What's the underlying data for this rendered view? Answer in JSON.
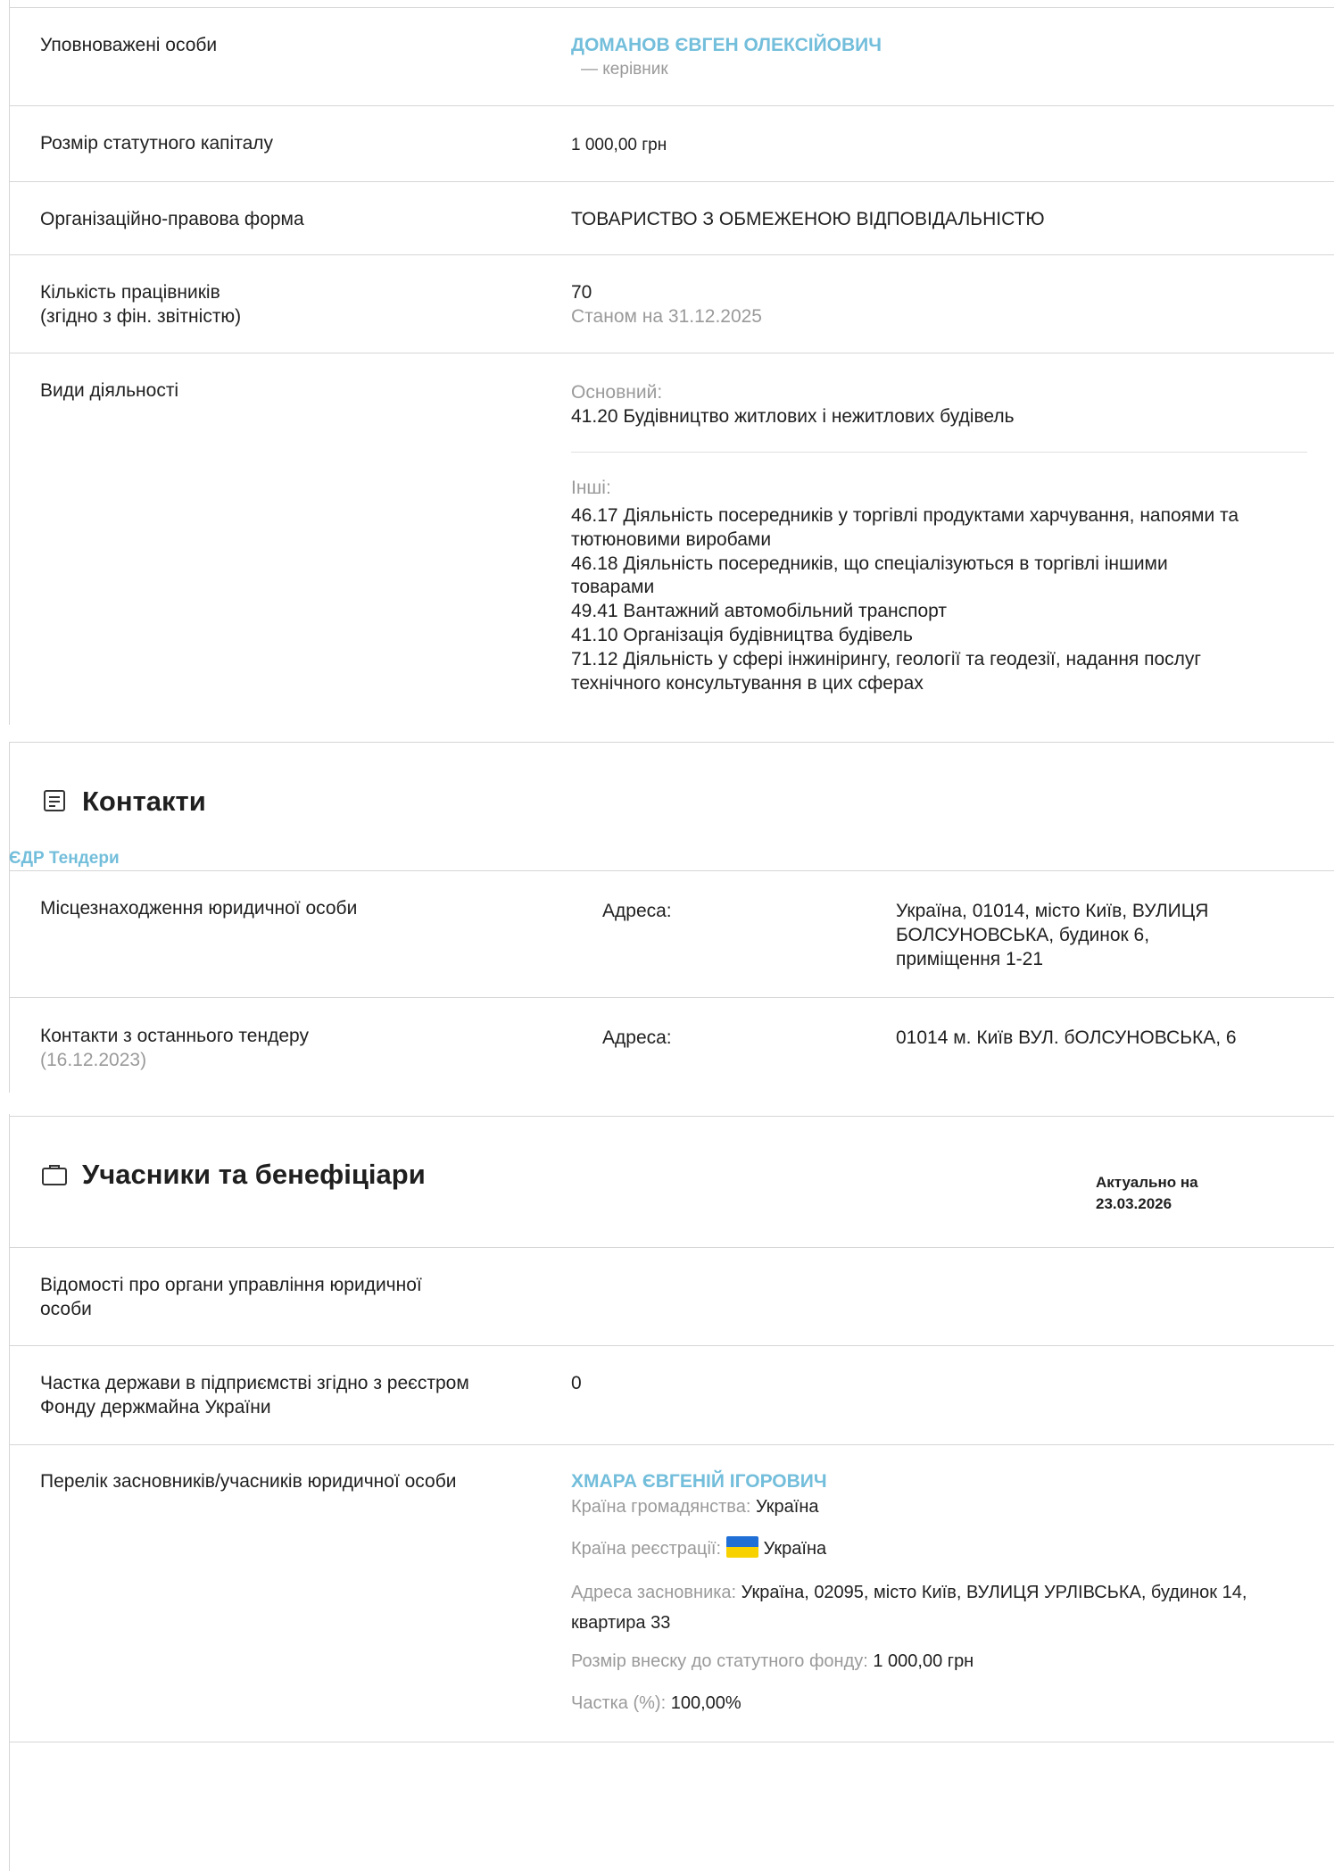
{
  "top_rows": {
    "authorized_persons": {
      "label": "Уповноважені особи",
      "name": "ДОМАНОВ ЄВГЕН ОЛЕКСІЙОВИЧ",
      "role": "— керівник"
    },
    "capital": {
      "label": "Розмір статутного капіталу",
      "value": "1 000,00 грн"
    },
    "legal_form": {
      "label": "Організаційно-правова форма",
      "value": "ТОВАРИСТВО З ОБМЕЖЕНОЮ ВІДПОВІДАЛЬНІСТЮ"
    },
    "employees": {
      "label_line1": "Кількість працівників",
      "label_line2": "(згідно з фін. звітністю)",
      "value": "70",
      "as_of": "Станом на 31.12.2025"
    },
    "activities": {
      "label": "Види діяльності",
      "main_caption": "Основний:",
      "main_value": "41.20 Будівництво житлових і нежитлових будівель",
      "other_caption": "Інші:",
      "other_lines": [
        "46.17 Діяльність посередників у торгівлі продуктами харчування, напоями та",
        "тютюновими виробами",
        "46.18 Діяльність посередників, що спеціалізуються в торгівлі іншими",
        "товарами",
        "49.41 Вантажний автомобільний транспорт",
        "41.10 Організація будівництва будівель",
        "71.12 Діяльність у сфері інжинірингу, геології та геодезії, надання послуг",
        "технічного консультування в цих сферах"
      ]
    }
  },
  "contacts": {
    "title": "Контакти",
    "source_tabs": "ЄДР Тендери",
    "location": {
      "label": "Місцезнаходження юридичної особи",
      "field": "Адреса:",
      "value_lines": [
        "Україна, 01014, місто Київ, ВУЛИЦЯ",
        "БОЛСУНОВСЬКА, будинок 6,",
        "приміщення 1-21"
      ]
    },
    "tender": {
      "label": "Контакти з останнього тендеру",
      "date": "(16.12.2023)",
      "field": "Адреса:",
      "value": "01014 м. Київ ВУЛ. бОЛСУНОВСЬКА, 6"
    }
  },
  "participants": {
    "title": "Учасники та бенефіціари",
    "actual_line1": "Актуально на",
    "actual_line2": "23.03.2026",
    "governance": {
      "label_line1": "Відомості про органи управління юридичної",
      "label_line2": "особи"
    },
    "state_share": {
      "label_line1": "Частка держави в підприємстві згідно з реєстром",
      "label_line2": "Фонду держмайна України",
      "value": "0"
    },
    "founders": {
      "label": "Перелік засновників/учасників юридичної особи",
      "name": "ХМАРА ЄВГЕНІЙ ІГОРОВИЧ",
      "citizenship_caption": "Країна громадянства:",
      "citizenship_value": "Україна",
      "registration_caption": "Країна реєстрації:",
      "registration_value": "Україна",
      "address_caption": "Адреса засновника:",
      "address_value_line1": "Україна, 02095, місто Київ, ВУЛИЦЯ УРЛІВСЬКА, будинок 14,",
      "address_value_line2": "квартира 33",
      "contribution_caption": "Розмір внеску до статутного фонду:",
      "contribution_value": "1 000,00 грн",
      "share_caption": "Частка (%):",
      "share_value": "100,00%"
    }
  },
  "colors": {
    "link": "#73bedb",
    "muted": "#9a9a9a",
    "divider": "#d6d6d6",
    "flag_blue": "#1f6fd6",
    "flag_yellow": "#f7d100"
  },
  "icons": {
    "contacts": "document-list-icon",
    "participants": "briefcase-icon"
  }
}
